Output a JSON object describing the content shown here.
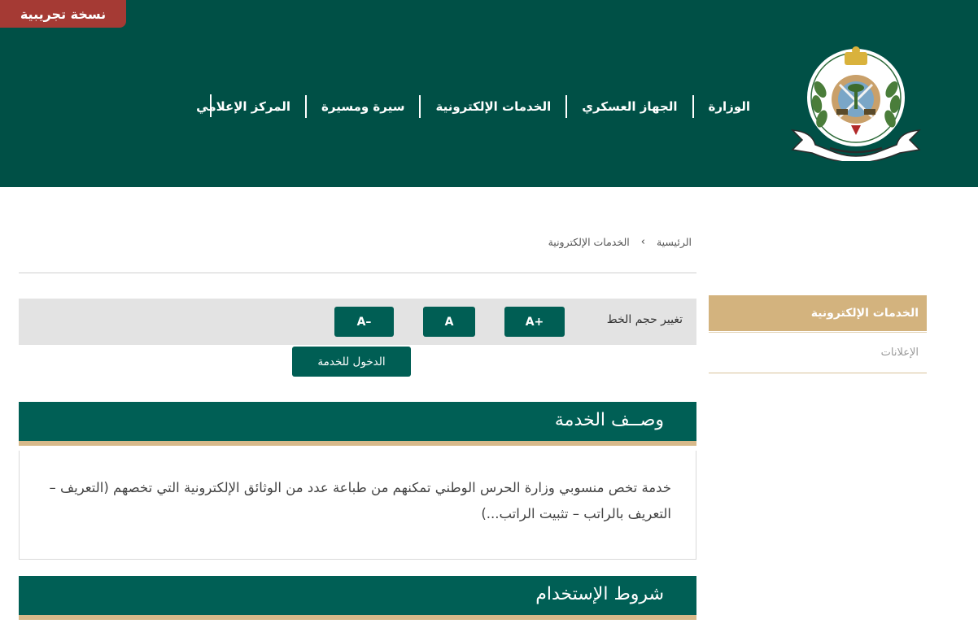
{
  "header": {
    "trial_badge": "نسخة تجريبية",
    "logo_icon": "ministry-emblem-icon",
    "nav": [
      {
        "label": "الوزارة"
      },
      {
        "label": "الجهاز العسكري"
      },
      {
        "label": "الخدمات الإلكترونية"
      },
      {
        "label": "سيرة ومسيرة"
      },
      {
        "label": "المركز الإعلامي"
      }
    ]
  },
  "breadcrumb": {
    "home": "الرئيسية",
    "separator": "›",
    "current": "الخدمات الإلكترونية"
  },
  "font_size": {
    "label": "تغيير حجم الخط",
    "increase": "A+",
    "normal": "A",
    "decrease": "A–"
  },
  "enter_service_label": "الدخول للخدمة",
  "service_description": {
    "title": "وصــف الخدمة",
    "text": "خدمة تخص منسوبي وزارة الحرس الوطني تمكنهم من طباعة عدد من الوثائق الإلكترونية التي تخصهم (التعريف – التعريف بالراتب – تثبيت الراتب...)"
  },
  "terms_of_use": {
    "title": "شروط الإستخدام"
  },
  "sidebar": {
    "items": [
      {
        "label": "الخدمات الإلكترونية",
        "active": true
      },
      {
        "label": "الإعلانات",
        "active": false
      }
    ]
  },
  "colors": {
    "header_bg": "#005046",
    "panel_bg": "#005f55",
    "accent_gold": "#d3b37e",
    "badge_red": "#a53a34"
  }
}
